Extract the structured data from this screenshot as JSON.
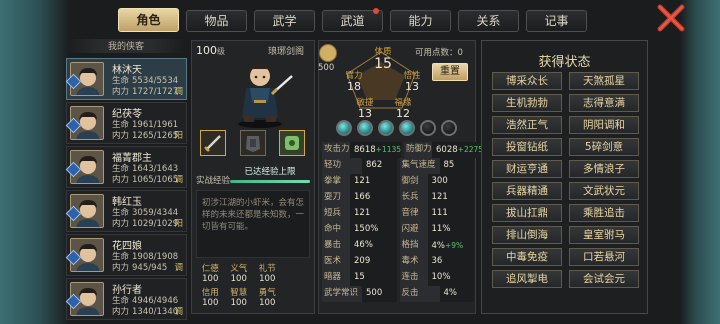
{
  "tabs": [
    {
      "label": "角色",
      "active": true
    },
    {
      "label": "物品"
    },
    {
      "label": "武学"
    },
    {
      "label": "武道",
      "dot": true
    },
    {
      "label": "能力"
    },
    {
      "label": "关系"
    },
    {
      "label": "记事"
    }
  ],
  "party": {
    "title": "我的侠客",
    "hp_label": "生命",
    "mp_label": "内力",
    "members": [
      {
        "name": "林沐天",
        "hp": "5534/5534",
        "mp": "1727/1727",
        "tag": "调",
        "active": true
      },
      {
        "name": "纪茯苓",
        "hp": "1961/1961",
        "mp": "1265/1265",
        "tag": "阳"
      },
      {
        "name": "福菁郡主",
        "hp": "1643/1643",
        "mp": "1065/1065",
        "tag": "调"
      },
      {
        "name": "韩红玉",
        "hp": "3059/4344",
        "mp": "1029/1029",
        "tag": "阳"
      },
      {
        "name": "花四娘",
        "hp": "1908/1908",
        "mp": "945/945",
        "tag": "调"
      },
      {
        "name": "孙行者",
        "hp": "4946/4946",
        "mp": "1340/1340",
        "tag": "调"
      }
    ]
  },
  "profile": {
    "level": "100",
    "level_unit": "级",
    "weapon_name": "琅琊剑阁",
    "exp_label": "实战经验",
    "exp_status": "已达经验上限",
    "bio": "初涉江湖的小虾米，会有怎样的未来还都是未知数，一切皆有可能。",
    "traits": [
      {
        "k": "仁德",
        "v": "100"
      },
      {
        "k": "义气",
        "v": "100"
      },
      {
        "k": "礼节",
        "v": "100"
      },
      {
        "k": "信用",
        "v": "100"
      },
      {
        "k": "智慧",
        "v": "100"
      },
      {
        "k": "勇气",
        "v": "100"
      }
    ]
  },
  "attributes": {
    "points_value": "500",
    "free_points_label": "可用点数：",
    "free_points": "0",
    "reset_label": "重置",
    "items": [
      {
        "k": "体质",
        "v": "15"
      },
      {
        "k": "臂力",
        "v": "18"
      },
      {
        "k": "悟性",
        "v": "13"
      },
      {
        "k": "敏捷",
        "v": "13"
      },
      {
        "k": "福缘",
        "v": "12"
      }
    ],
    "orbs": [
      true,
      true,
      true,
      true,
      false,
      false
    ]
  },
  "stats": {
    "rows": [
      [
        {
          "k": "攻击力",
          "v": "8618",
          "bonus": "+1135"
        },
        {
          "k": "防御力",
          "v": "6028",
          "bonus": "+2275"
        }
      ],
      [
        {
          "k": "轻功",
          "v": "862"
        },
        {
          "k": "集气速度",
          "v": "85"
        }
      ],
      [
        {
          "k": "拳掌",
          "v": "121"
        },
        {
          "k": "御剑",
          "v": "300"
        }
      ],
      [
        {
          "k": "耍刀",
          "v": "166"
        },
        {
          "k": "长兵",
          "v": "121"
        }
      ],
      [
        {
          "k": "短兵",
          "v": "121"
        },
        {
          "k": "音律",
          "v": "111"
        }
      ],
      [
        {
          "k": "命中",
          "v": "150%"
        },
        {
          "k": "闪避",
          "v": "11%"
        }
      ],
      [
        {
          "k": "暴击",
          "v": "46%"
        },
        {
          "k": "格挡",
          "v": "4%",
          "bonus": "+9%"
        }
      ],
      [
        {
          "k": "医术",
          "v": "209"
        },
        {
          "k": "毒术",
          "v": "36"
        }
      ],
      [
        {
          "k": "暗器",
          "v": "15"
        },
        {
          "k": "连击",
          "v": "10%"
        }
      ],
      [
        {
          "k": "武学常识",
          "v": "500"
        },
        {
          "k": "反击",
          "v": "4%"
        }
      ]
    ]
  },
  "status": {
    "title": "获得状态",
    "items": [
      "博采众长",
      "天煞孤星",
      "生机勃勃",
      "志得意满",
      "浩然正气",
      "阴阳调和",
      "投窗钻纸",
      "5碎剑意",
      "财运亨通",
      "多情浪子",
      "兵器精通",
      "文武状元",
      "拔山扛鼎",
      "乘胜追击",
      "排山倒海",
      "皇室驸马",
      "中毒免疫",
      "口若悬河",
      "追风掣电",
      "会试会元"
    ]
  },
  "colors": {
    "accent_gold": "#e9d6a4",
    "active_row": "#2c3d46",
    "bonus_green": "#58c46c",
    "close_red": "#e04a33"
  }
}
